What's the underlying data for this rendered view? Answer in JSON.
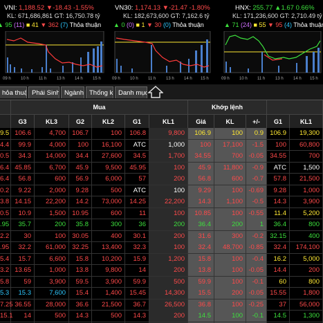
{
  "indices": [
    {
      "name": "VNI:",
      "value": "1,188.52",
      "arrow": "▼",
      "change": "-18.43",
      "pct": "-1.55%",
      "kl": "KL: 671,686,861",
      "gt": "GT: 16,750.78 tỷ",
      "up": "95",
      "ref": "(11)",
      "flat": "41",
      "down": "362",
      "down_floor": "(7)",
      "tt": "Thỏa thuận"
    },
    {
      "name": "VN30:",
      "value": "1,174.13",
      "arrow": "▼",
      "change": "-21.47",
      "pct": "-1.80%",
      "kl": "KL: 182,673,600",
      "gt": "GT: 7,162.6 tỷ",
      "up": "0",
      "ref": "(0)",
      "flat": "1",
      "down": "30",
      "down_floor": "(0)",
      "tt": "Thỏa thuận"
    },
    {
      "name": "HNX:",
      "value": "255.77",
      "arrow": "▲",
      "change": "1.67",
      "pct": "0.66%",
      "kl": "KL: 171,236,600",
      "gt": "GT: 2,710.49 tỷ",
      "up": "71",
      "ref": "(24)",
      "flat": "55",
      "down": "95",
      "down_floor": "(4)",
      "tt": "Thỏa thuận"
    }
  ],
  "chart_times": [
    "09 h",
    "10 h",
    "11 h",
    "13 h",
    "14 h",
    "15 h"
  ],
  "tabs": [
    "hỏa thuận",
    "Phái Sinh",
    "Ngành",
    "Thống kê",
    "Danh mục"
  ],
  "groups": {
    "mua": "Mua",
    "khop": "Khớp lệnh"
  },
  "columns": [
    "",
    "G3",
    "KL3",
    "G2",
    "KL2",
    "G1",
    "KL1",
    "Giá",
    "KL",
    "+/-",
    "G1",
    "KL1"
  ],
  "rows": [
    {
      "c": [
        "9.5",
        "106.6",
        "4,700",
        "106.7",
        "100",
        "106.8",
        "9,800",
        "106.9",
        "100",
        "0.9",
        "106.9",
        "19,300"
      ],
      "k": [
        "yel",
        "red",
        "red",
        "red",
        "red",
        "red",
        "red",
        "yel",
        "yel",
        "yel",
        "yel",
        "yel"
      ]
    },
    {
      "c": [
        "4.4",
        "99.9",
        "4,000",
        "100",
        "16,100",
        "ATC",
        "1,000",
        "100",
        "17,100",
        "-1.5",
        "100",
        "60,800"
      ],
      "k": [
        "red",
        "red",
        "red",
        "red",
        "red",
        "wht",
        "wht",
        "red",
        "red",
        "red",
        "red",
        "red"
      ]
    },
    {
      "c": [
        "0.5",
        "34.3",
        "14,000",
        "34.4",
        "27,600",
        "34.5",
        "1,700",
        "34.55",
        "700",
        "-0.05",
        "34.55",
        "700"
      ],
      "k": [
        "red",
        "red",
        "red",
        "red",
        "red",
        "red",
        "red",
        "red",
        "red",
        "red",
        "red",
        "red"
      ]
    },
    {
      "c": [
        "6.4",
        "45.85",
        "6,700",
        "45.9",
        "9,500",
        "45.95",
        "100",
        "45.9",
        "11,800",
        "-0.9",
        "ATC",
        "1,500"
      ],
      "k": [
        "red",
        "red",
        "red",
        "red",
        "red",
        "red",
        "red",
        "red",
        "red",
        "red",
        "wht",
        "wht"
      ]
    },
    {
      "c": [
        "6.4",
        "56.8",
        "600",
        "56.9",
        "6,000",
        "57",
        "200",
        "56.8",
        "600",
        "-0.7",
        "57.8",
        "21,500"
      ],
      "k": [
        "red",
        "red",
        "red",
        "red",
        "red",
        "red",
        "red",
        "red",
        "red",
        "red",
        "red",
        "red"
      ]
    },
    {
      "c": [
        "0.2",
        "9.22",
        "2,000",
        "9.28",
        "500",
        "ATC",
        "100",
        "9.29",
        "100",
        "-0.69",
        "9.28",
        "1,000"
      ],
      "k": [
        "red",
        "red",
        "red",
        "red",
        "red",
        "wht",
        "wht",
        "red",
        "red",
        "red",
        "red",
        "red"
      ]
    },
    {
      "c": [
        "3.8",
        "14.15",
        "22,200",
        "14.2",
        "73,000",
        "14.25",
        "22,200",
        "14.3",
        "1,100",
        "-0.5",
        "14.3",
        "3,900"
      ],
      "k": [
        "red",
        "red",
        "red",
        "red",
        "red",
        "red",
        "red",
        "red",
        "red",
        "red",
        "red",
        "red"
      ]
    },
    {
      "c": [
        "0.5",
        "10.9",
        "1,500",
        "10.95",
        "600",
        "11",
        "100",
        "10.85",
        "100",
        "-0.55",
        "11.4",
        "5,200"
      ],
      "k": [
        "red",
        "red",
        "red",
        "red",
        "red",
        "red",
        "red",
        "red",
        "red",
        "red",
        "yel",
        "yel"
      ]
    },
    {
      "c": [
        ".95",
        "35.7",
        "200",
        "35.8",
        "300",
        "36",
        "200",
        "36.4",
        "200",
        "1",
        "36.4",
        "800"
      ],
      "k": [
        "grn",
        "grn",
        "grn",
        "grn",
        "grn",
        "grn",
        "grn",
        "grn",
        "grn",
        "grn",
        "grn",
        "grn"
      ]
    },
    {
      "c": [
        "2.2",
        "30",
        "100",
        "30.05",
        "400",
        "30.1",
        "200",
        "31.6",
        "300",
        "-0.2",
        "32.15",
        "400"
      ],
      "k": [
        "red",
        "red",
        "red",
        "red",
        "red",
        "red",
        "red",
        "red",
        "red",
        "red",
        "grn",
        "grn"
      ]
    },
    {
      "c": [
        ".95",
        "32.2",
        "61,000",
        "32.25",
        "13,400",
        "32.3",
        "100",
        "32.4",
        "48,700",
        "-0.85",
        "32.4",
        "174,100"
      ],
      "k": [
        "red",
        "red",
        "red",
        "red",
        "red",
        "red",
        "red",
        "red",
        "red",
        "red",
        "red",
        "red"
      ]
    },
    {
      "c": [
        "5.4",
        "15.7",
        "6,600",
        "15.8",
        "10,200",
        "15.9",
        "1,200",
        "15.8",
        "100",
        "-0.4",
        "16.2",
        "5,000"
      ],
      "k": [
        "red",
        "red",
        "red",
        "red",
        "red",
        "red",
        "red",
        "red",
        "red",
        "red",
        "yel",
        "yel"
      ]
    },
    {
      "c": [
        "3.2",
        "13.65",
        "1,000",
        "13.8",
        "9,800",
        "14",
        "200",
        "13.8",
        "100",
        "-0.05",
        "14.4",
        "200"
      ],
      "k": [
        "red",
        "red",
        "red",
        "red",
        "red",
        "red",
        "red",
        "red",
        "red",
        "red",
        "red",
        "red"
      ]
    },
    {
      "c": [
        "5.8",
        "59",
        "3,900",
        "59.5",
        "3,900",
        "59.9",
        "500",
        "59.9",
        "100",
        "-0.1",
        "60",
        "800"
      ],
      "k": [
        "red",
        "red",
        "red",
        "red",
        "red",
        "red",
        "red",
        "red",
        "red",
        "red",
        "yel",
        "yel"
      ]
    },
    {
      "c": [
        "5.3",
        "15.3",
        "7,600",
        "15.4",
        "1,400",
        "15.45",
        "14,300",
        "15.5",
        "200",
        "-0.05",
        "15.55",
        "1,800"
      ],
      "k": [
        "cy",
        "cy",
        "cy",
        "red",
        "red",
        "red",
        "red",
        "red",
        "red",
        "red",
        "red",
        "red"
      ]
    },
    {
      "c": [
        "7.25",
        "36.55",
        "28,000",
        "36.6",
        "21,500",
        "36.7",
        "26,500",
        "36.8",
        "100",
        "-0.25",
        "37",
        "56,000"
      ],
      "k": [
        "red",
        "red",
        "red",
        "red",
        "red",
        "red",
        "red",
        "red",
        "red",
        "red",
        "red",
        "red"
      ]
    },
    {
      "c": [
        "15.1",
        "14",
        "500",
        "14.3",
        "500",
        "14.3",
        "200",
        "14.5",
        "100",
        "-0.1",
        "14.5",
        "1,300"
      ],
      "k": [
        "red",
        "red",
        "red",
        "red",
        "red",
        "red",
        "red",
        "grn",
        "grn",
        "grn",
        "grn",
        "grn"
      ]
    },
    {
      "c": [
        "",
        "",
        "",
        "",
        "",
        "",
        "",
        "",
        "10,000",
        "",
        "",
        ""
      ],
      "k": [
        "wht",
        "wht",
        "wht",
        "wht",
        "wht",
        "wht",
        "wht",
        "wht",
        "wht",
        "wht",
        "wht",
        "wht"
      ]
    }
  ],
  "colors": {
    "red": "#ff4a4a",
    "green": "#3de03d",
    "yellow": "#ffe833",
    "purple": "#d070ff",
    "cyan": "#2ec8ff"
  }
}
